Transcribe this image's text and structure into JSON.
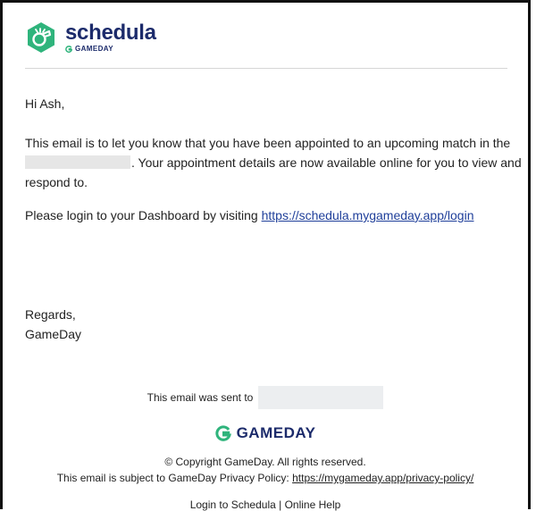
{
  "header": {
    "brand_name": "schedula",
    "brand_sub": "GAMEDAY"
  },
  "email": {
    "greeting": "Hi Ash,",
    "para_1a": "This email is to let you know that you have been appointed to an upcoming match in the",
    "para_1b": ". Your appointment details are now available online for you to view and respond to.",
    "login_text": "Please login to your Dashboard by visiting ",
    "login_link": "https://schedula.mygameday.app/login",
    "regards": "Regards,",
    "signature": "GameDay"
  },
  "footer": {
    "sent_to": "This email was sent to",
    "logo_text": "GAMEDAY",
    "copyright": "© Copyright GameDay. All rights reserved.",
    "privacy_text": "This email is subject to GameDay Privacy Policy: ",
    "privacy_link": "https://mygameday.app/privacy-policy/",
    "link_login": "Login to Schedula",
    "separator": " | ",
    "link_help": "Online Help"
  },
  "colors": {
    "brand_navy": "#1c2b6b",
    "brand_green": "#2fb47c",
    "link_blue": "#1f3f9a"
  },
  "icons": [
    "schedula-whistle-icon",
    "gameday-g-icon"
  ]
}
